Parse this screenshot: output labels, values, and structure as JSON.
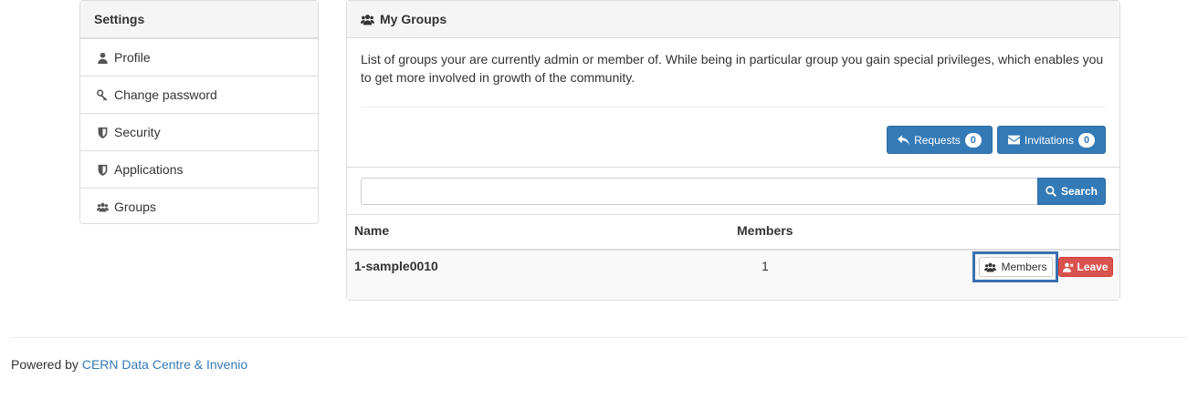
{
  "sidebar": {
    "title": "Settings",
    "items": [
      {
        "label": "Profile",
        "icon": "user-icon"
      },
      {
        "label": "Change password",
        "icon": "key-icon"
      },
      {
        "label": "Security",
        "icon": "shield-icon"
      },
      {
        "label": "Applications",
        "icon": "shield-icon"
      },
      {
        "label": "Groups",
        "icon": "users-icon"
      }
    ]
  },
  "main": {
    "title": "My Groups",
    "description": "List of groups your are currently admin or member of. While being in particular group you gain special privileges, which enables you to get more involved in growth of the community.",
    "requests_label": "Requests",
    "requests_count": "0",
    "invitations_label": "Invitations",
    "invitations_count": "0",
    "search": {
      "value": "",
      "button_label": "Search"
    },
    "table": {
      "headers": [
        "Name",
        "Members"
      ],
      "rows": [
        {
          "name": "1-sample0010",
          "members": "1",
          "members_button": "Members",
          "leave_button": "Leave"
        }
      ]
    }
  },
  "footer": {
    "prefix": "Powered by",
    "link_text": "CERN Data Centre & Invenio"
  },
  "colors": {
    "primary": "#337ab7",
    "danger": "#d9534f",
    "focus_outline": "#3a6faf"
  }
}
